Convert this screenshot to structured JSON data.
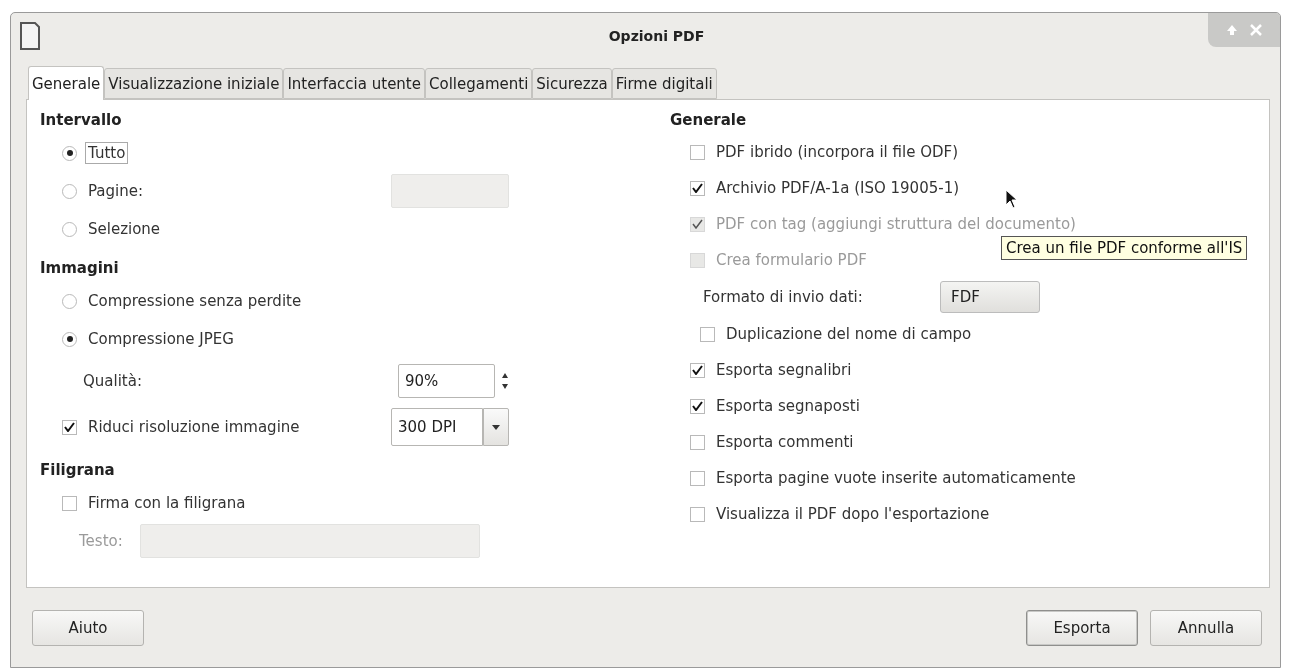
{
  "window": {
    "title": "Opzioni PDF"
  },
  "tabs": [
    {
      "label": "Generale",
      "selected": true
    },
    {
      "label": "Visualizzazione iniziale",
      "selected": false
    },
    {
      "label": "Interfaccia utente",
      "selected": false
    },
    {
      "label": "Collegamenti",
      "selected": false
    },
    {
      "label": "Sicurezza",
      "selected": false
    },
    {
      "label": "Firme digitali",
      "selected": false
    }
  ],
  "left_sections": [
    {
      "title": "Intervallo",
      "items": [
        {
          "kind": "radio",
          "label": "Tutto",
          "selected": true,
          "focused": true
        },
        {
          "kind": "radio",
          "label": "Pagine:",
          "selected": false,
          "focused": false,
          "field": {
            "disabled": true
          }
        },
        {
          "kind": "radio",
          "label": "Selezione",
          "selected": false,
          "focused": false
        }
      ]
    },
    {
      "title": "Immagini",
      "items": [
        {
          "kind": "radio",
          "label": "Compressione senza perdite",
          "selected": false,
          "focused": false
        },
        {
          "kind": "radio",
          "label": "Compressione JPEG",
          "selected": true,
          "focused": false
        },
        {
          "kind": "spin",
          "label": "Qualità:",
          "value": "90%"
        },
        {
          "kind": "combo",
          "label": "Riduci risoluzione immagine",
          "checked": true,
          "value": "300 DPI"
        }
      ]
    },
    {
      "title": "Filigrana",
      "items": [
        {
          "kind": "checkbox",
          "label": "Firma con la filigrana",
          "checked": false,
          "disabled": false
        },
        {
          "kind": "textfield",
          "label": "Testo:",
          "disabled": true
        }
      ]
    }
  ],
  "right_section": {
    "title": "Generale",
    "items": [
      {
        "kind": "checkbox",
        "label": "PDF ibrido (incorpora il file ODF)",
        "checked": false,
        "disabled": false
      },
      {
        "kind": "checkbox",
        "label": "Archivio PDF/A-1a (ISO 19005-1)",
        "checked": true,
        "disabled": false
      },
      {
        "kind": "checkbox",
        "label": "PDF con tag (aggiungi struttura del documento)",
        "checked": true,
        "disabled": true
      },
      {
        "kind": "checkbox",
        "label": "Crea formulario PDF",
        "checked": false,
        "disabled": true
      },
      {
        "kind": "select",
        "label": "Formato di invio dati:",
        "value": "FDF"
      },
      {
        "kind": "sub_checkbox",
        "label": "Duplicazione del nome di campo",
        "checked": false,
        "disabled": false
      },
      {
        "kind": "checkbox",
        "label": "Esporta segnalibri",
        "checked": true,
        "disabled": false
      },
      {
        "kind": "checkbox",
        "label": "Esporta segnaposti",
        "checked": true,
        "disabled": false
      },
      {
        "kind": "checkbox",
        "label": "Esporta commenti",
        "checked": false,
        "disabled": false
      },
      {
        "kind": "checkbox",
        "label": "Esporta pagine vuote inserite automaticamente",
        "checked": false,
        "disabled": false
      },
      {
        "kind": "checkbox",
        "label": "Visualizza il PDF dopo l'esportazione",
        "checked": false,
        "disabled": false
      }
    ]
  },
  "tooltip": "Crea un file PDF conforme all'IS",
  "buttons_left": [
    {
      "label": "Aiuto",
      "default": false
    }
  ],
  "buttons_right": [
    {
      "label": "Esporta",
      "default": true
    },
    {
      "label": "Annulla",
      "default": false
    }
  ]
}
